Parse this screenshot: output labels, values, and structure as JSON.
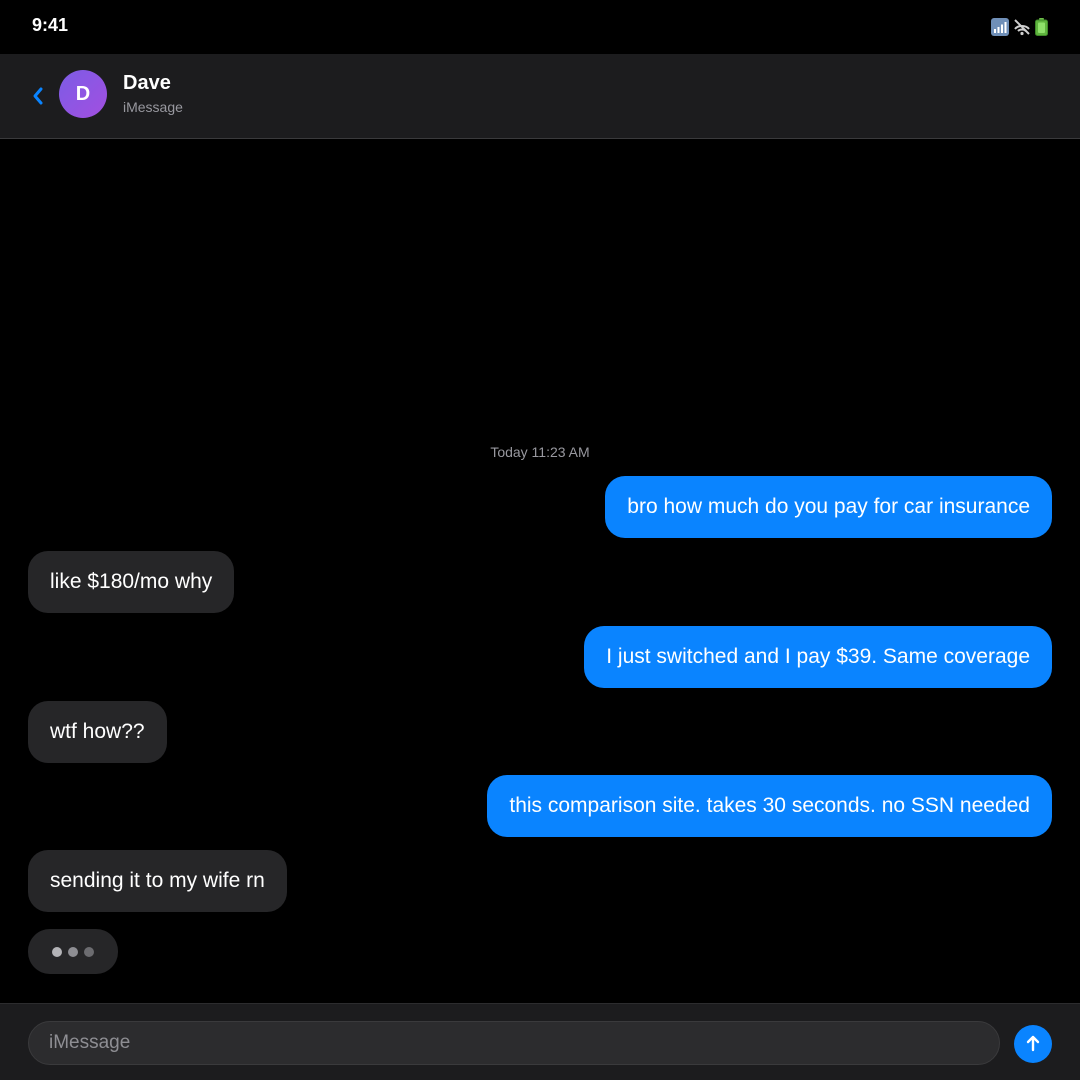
{
  "status_bar": {
    "time": "9:41",
    "icons": [
      "cellular-signal-icon",
      "wifi-off-icon",
      "battery-icon"
    ]
  },
  "header": {
    "back_icon": "chevron-left-icon",
    "avatar_initial": "D",
    "contact_name": "Dave",
    "service": "iMessage"
  },
  "conversation": {
    "timestamp": "Today 11:23 AM",
    "messages": [
      {
        "from": "me",
        "text": "bro how much do you pay for car insurance"
      },
      {
        "from": "dave",
        "text": "like $180/mo why"
      },
      {
        "from": "me",
        "text": "I just switched and I pay $39. Same coverage"
      },
      {
        "from": "dave",
        "text": "wtf how??"
      },
      {
        "from": "me",
        "text": "this comparison site. takes 30 seconds. no SSN needed"
      },
      {
        "from": "dave",
        "text": "sending it to my wife rn"
      }
    ],
    "typing_indicator": true
  },
  "composer": {
    "placeholder": "iMessage",
    "value": "",
    "send_icon": "arrow-up-icon"
  },
  "colors": {
    "background": "#000000",
    "header_background": "#1c1c1e",
    "sent_bubble": "#0a84ff",
    "received_bubble": "#262628",
    "secondary_text": "#98989f",
    "accent": "#0a84ff",
    "avatar_gradient_start": "#7c5ce6",
    "avatar_gradient_end": "#a24fe0"
  }
}
